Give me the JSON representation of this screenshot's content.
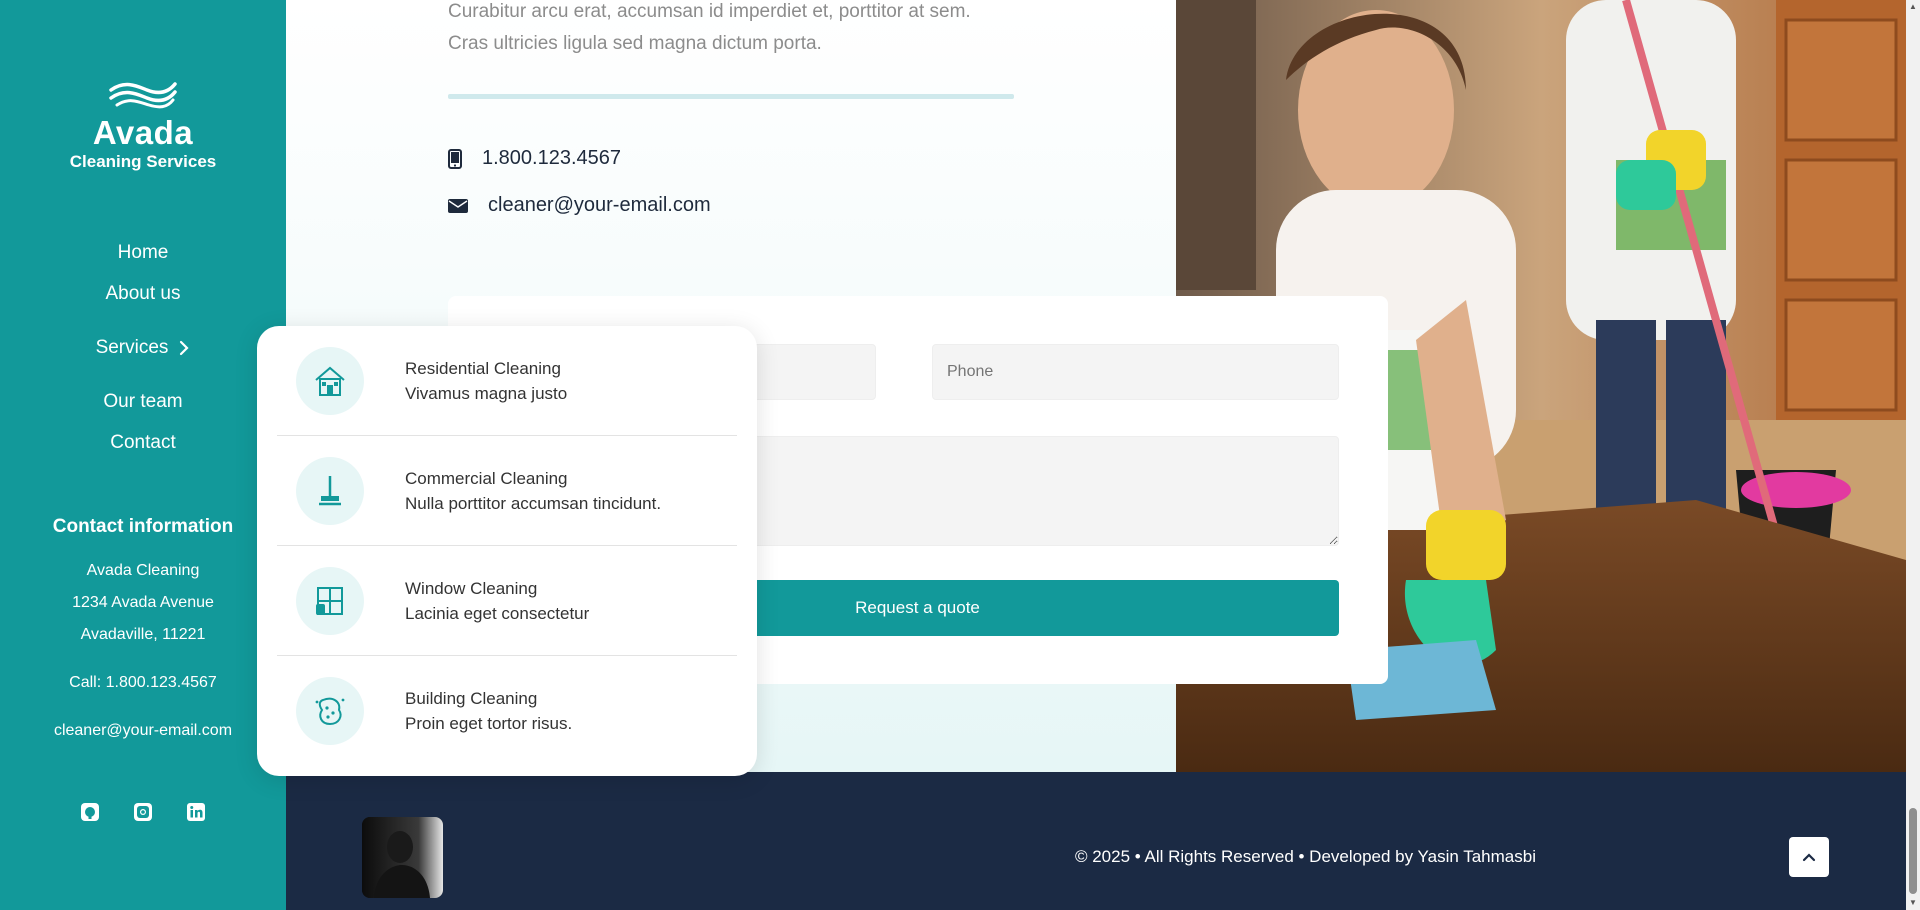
{
  "brand": {
    "name": "Avada",
    "subtitle": "Cleaning Services"
  },
  "nav": {
    "home": "Home",
    "about": "About us",
    "services": "Services",
    "team": "Our team",
    "contact": "Contact"
  },
  "contact_info": {
    "title": "Contact information",
    "company": "Avada Cleaning",
    "street": "1234 Avada Avenue",
    "city": "Avadaville, 11221",
    "call": "Call: 1.800.123.4567",
    "email": "cleaner@your-email.com"
  },
  "socials": [
    "github-icon",
    "instagram-icon",
    "linkedin-icon"
  ],
  "main": {
    "lead_line_1": "Curabitur arcu erat, accumsan id imperdiet et, porttitor at sem.",
    "lead_line_2": "Cras ultricies ligula sed magna dictum porta.",
    "phone": "1.800.123.4567",
    "email": "cleaner@your-email.com"
  },
  "form": {
    "phone_placeholder": "Phone",
    "submit_label": "Request a quote"
  },
  "dropdown": {
    "items": [
      {
        "title": "Residential Cleaning",
        "desc": "Vivamus magna justo",
        "icon": "house-icon"
      },
      {
        "title": "Commercial Cleaning",
        "desc": "Nulla porttitor accumsan tincidunt.",
        "icon": "mop-icon"
      },
      {
        "title": "Window Cleaning",
        "desc": "Lacinia eget consectetur",
        "icon": "window-icon"
      },
      {
        "title": "Building Cleaning",
        "desc": "Proin eget tortor risus.",
        "icon": "sponge-icon"
      }
    ]
  },
  "footer": {
    "copyright": "© 2025 • All Rights Reserved • Developed by Yasin Tahmasbi"
  },
  "colors": {
    "primary": "#12999a",
    "footer": "#1b2a44",
    "text_dark": "#1e2a3c"
  }
}
